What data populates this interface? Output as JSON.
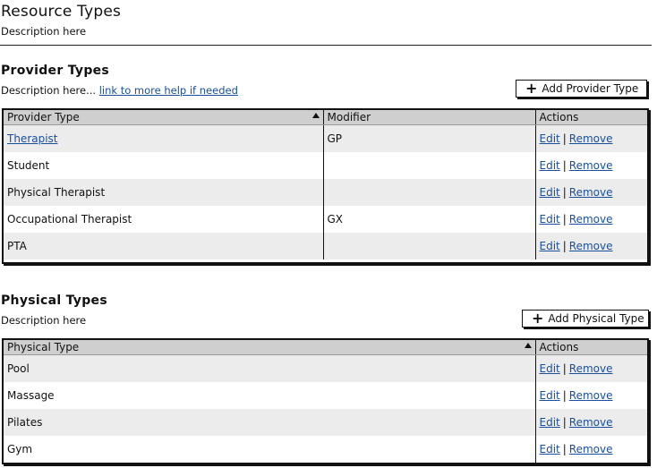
{
  "page": {
    "title": "Resource Types",
    "description": "Description here"
  },
  "provider": {
    "title": "Provider Types",
    "description": "Description here...",
    "help_link": "link to more help if needed",
    "add_button": "Add Provider Type",
    "columns": [
      "Provider Type",
      "Modifier",
      "Actions"
    ],
    "rows": [
      {
        "name": "Therapist",
        "modifier": "GP",
        "is_link": true
      },
      {
        "name": "Student",
        "modifier": ""
      },
      {
        "name": "Physical Therapist",
        "modifier": ""
      },
      {
        "name": "Occupational Therapist",
        "modifier": "GX"
      },
      {
        "name": "PTA",
        "modifier": ""
      }
    ]
  },
  "physical": {
    "title": "Physical Types",
    "description": "Description here",
    "add_button": "Add Physical Type",
    "columns": [
      "Physical Type",
      "Actions"
    ],
    "rows": [
      {
        "name": "Pool"
      },
      {
        "name": "Massage"
      },
      {
        "name": "Pilates"
      },
      {
        "name": "Gym"
      }
    ]
  },
  "actions": {
    "edit": "Edit",
    "separator": "|",
    "remove": "Remove"
  },
  "icons": {
    "add": "plus-icon",
    "sort": "sort-ascending-icon"
  }
}
